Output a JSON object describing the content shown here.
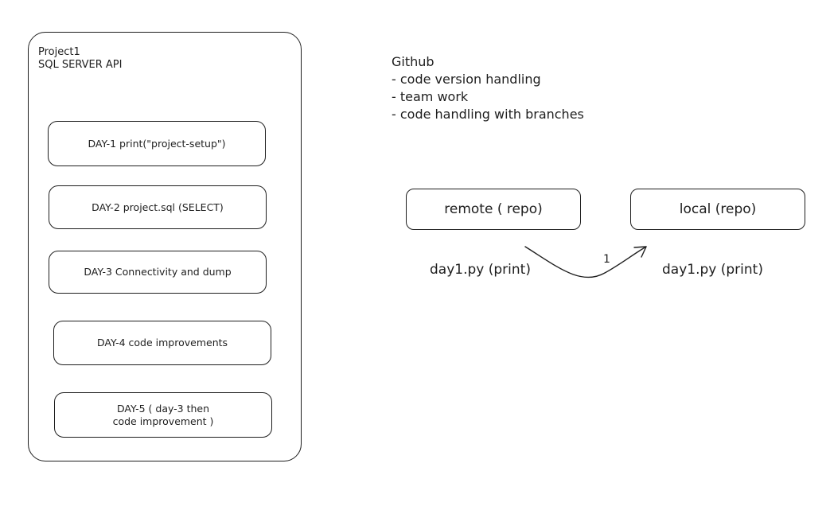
{
  "project": {
    "title": "Project1\nSQL SERVER API",
    "days": [
      {
        "label": "DAY-1 print(\"project-setup\")"
      },
      {
        "label": "DAY-2 project.sql (SELECT)"
      },
      {
        "label": "DAY-3  Connectivity and dump"
      },
      {
        "label": "DAY-4 code improvements"
      },
      {
        "label": "DAY-5 ( day-3 then\ncode improvement )"
      }
    ]
  },
  "github": {
    "heading": "Github",
    "points": [
      "- code version handling",
      "- team work",
      "- code handling with branches"
    ]
  },
  "flow": {
    "remote_label": "remote ( repo)",
    "local_label": "local (repo)",
    "remote_file": "day1.py (print)",
    "local_file": "day1.py (print)",
    "arrow_label": "1",
    "stroke_color": "#1e1e1e"
  }
}
